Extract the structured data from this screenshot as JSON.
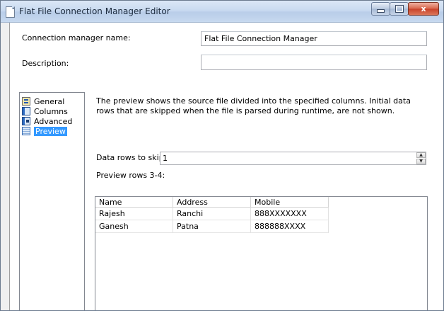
{
  "window": {
    "title": "Flat File Connection Manager Editor",
    "buttons": {
      "minimize": "–",
      "maximize": "□",
      "close": "x"
    }
  },
  "form": {
    "name_label": "Connection manager name:",
    "name_value": "Flat File Connection Manager",
    "description_label": "Description:",
    "description_value": ""
  },
  "nav": {
    "items": [
      {
        "label": "General",
        "icon": "general-icon",
        "selected": false
      },
      {
        "label": "Columns",
        "icon": "columns-icon",
        "selected": false
      },
      {
        "label": "Advanced",
        "icon": "advanced-icon",
        "selected": false
      },
      {
        "label": "Preview",
        "icon": "preview-icon",
        "selected": true
      }
    ]
  },
  "preview": {
    "description": "The preview shows the source file divided into the specified columns. Initial data rows that are skipped when the file is parsed during runtime, are not shown.",
    "skip_label": "Data rows to skip:",
    "skip_value": "1",
    "rows_label": "Preview rows 3-4:",
    "columns": [
      "Name",
      "Address",
      "Mobile"
    ],
    "rows": [
      [
        "Rajesh",
        "Ranchi",
        "888XXXXXXX"
      ],
      [
        "Ganesh",
        "Patna",
        "888888XXXX"
      ]
    ]
  }
}
